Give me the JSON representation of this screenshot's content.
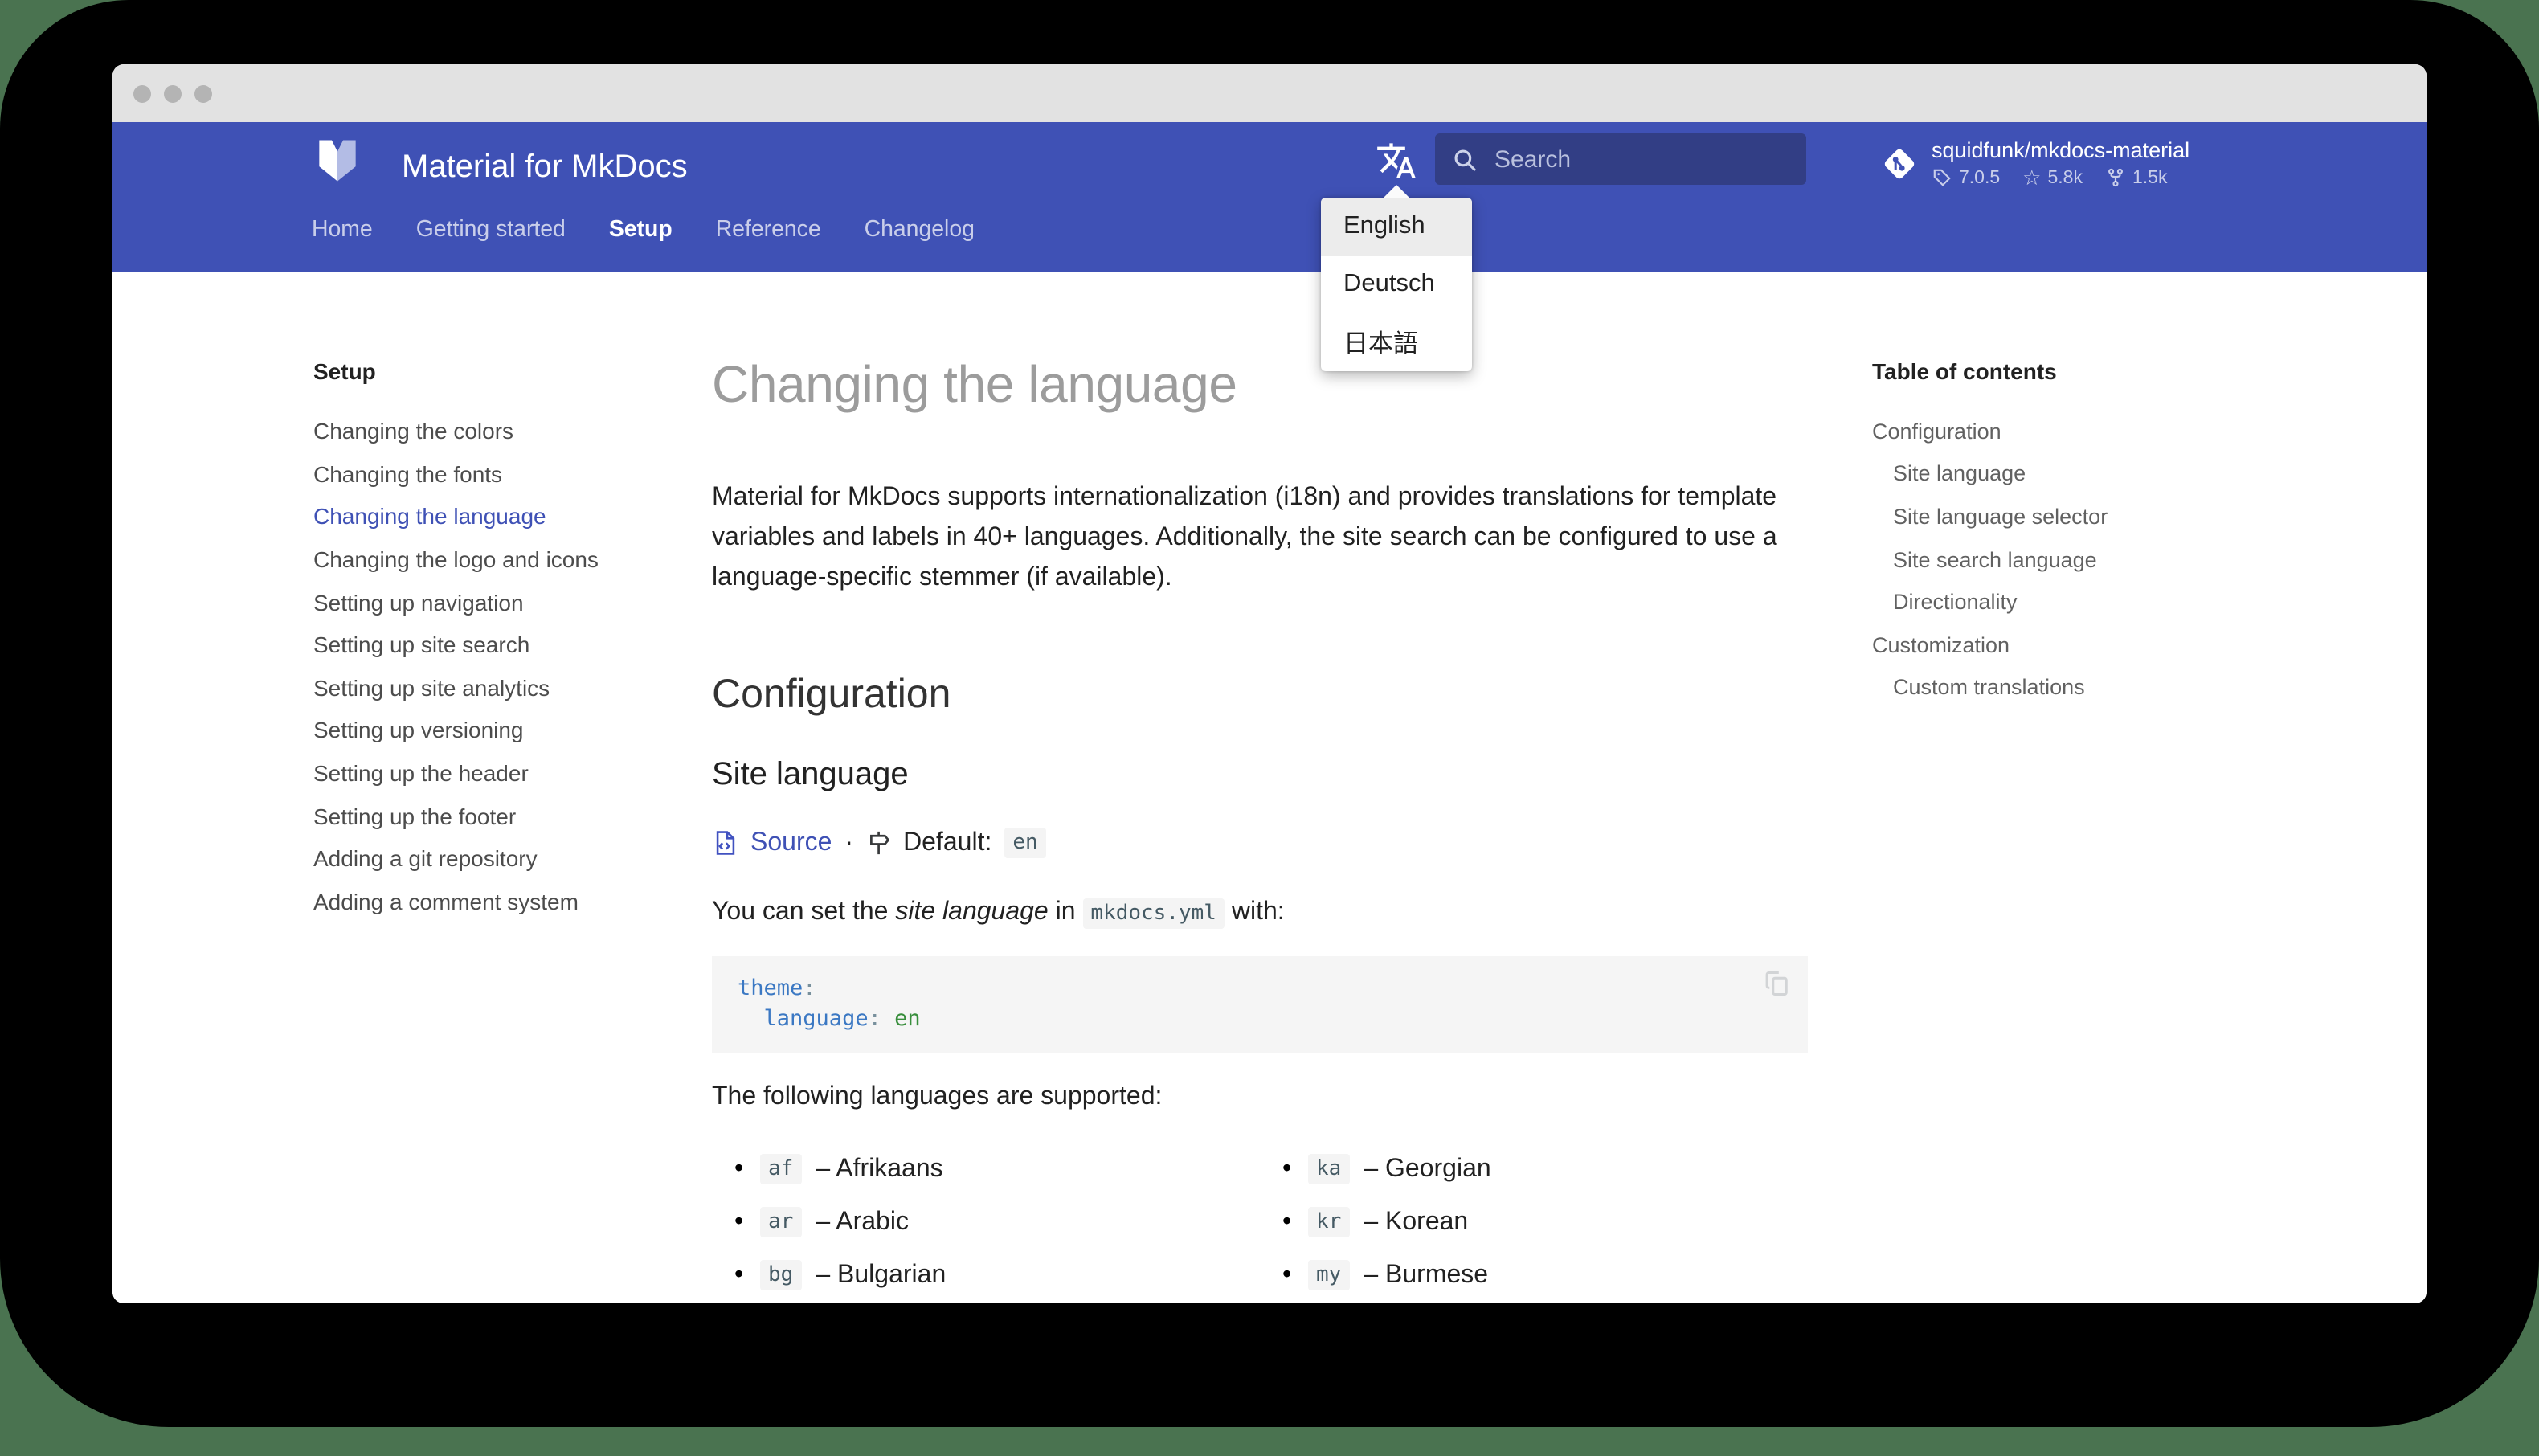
{
  "colors": {
    "desktop": "#4a7350",
    "header": "#3f51b5",
    "accent": "#3f51b5",
    "code_key": "#3b78c3",
    "code_value": "#388e3c"
  },
  "header": {
    "title": "Material for MkDocs",
    "search_placeholder": "Search",
    "tabs": [
      {
        "label": "Home",
        "class": ""
      },
      {
        "label": "Getting started",
        "class": ""
      },
      {
        "label": "Setup",
        "class": "active"
      },
      {
        "label": "Reference",
        "class": ""
      },
      {
        "label": "Changelog",
        "class": ""
      }
    ],
    "repo": {
      "name": "squidfunk/mkdocs-material",
      "version": "7.0.5",
      "stars": "5.8k",
      "forks": "1.5k"
    }
  },
  "language_menu": {
    "items": [
      {
        "label": "English",
        "class": "active"
      },
      {
        "label": "Deutsch",
        "class": ""
      },
      {
        "label": "日本語",
        "class": ""
      }
    ]
  },
  "sidebar": {
    "title": "Setup",
    "items": [
      {
        "label": "Changing the colors",
        "class": ""
      },
      {
        "label": "Changing the fonts",
        "class": ""
      },
      {
        "label": "Changing the language",
        "class": "active"
      },
      {
        "label": "Changing the logo and icons",
        "class": ""
      },
      {
        "label": "Setting up navigation",
        "class": ""
      },
      {
        "label": "Setting up site search",
        "class": ""
      },
      {
        "label": "Setting up site analytics",
        "class": ""
      },
      {
        "label": "Setting up versioning",
        "class": ""
      },
      {
        "label": "Setting up the header",
        "class": ""
      },
      {
        "label": "Setting up the footer",
        "class": ""
      },
      {
        "label": "Adding a git repository",
        "class": ""
      },
      {
        "label": "Adding a comment system",
        "class": ""
      }
    ]
  },
  "toc": {
    "title": "Table of contents",
    "items": [
      {
        "label": "Configuration",
        "class": ""
      },
      {
        "label": "Site language",
        "class": "lvl2"
      },
      {
        "label": "Site language selector",
        "class": "lvl2"
      },
      {
        "label": "Site search language",
        "class": "lvl2"
      },
      {
        "label": "Directionality",
        "class": "lvl2"
      },
      {
        "label": "Customization",
        "class": ""
      },
      {
        "label": "Custom translations",
        "class": "lvl2"
      }
    ]
  },
  "content": {
    "h1": "Changing the language",
    "intro": "Material for MkDocs supports internationalization (i18n) and provides translations for template variables and labels in 40+ languages. Additionally, the site search can be configured to use a language-specific stemmer (if available).",
    "h2": "Configuration",
    "h3": "Site language",
    "source_label": "Source",
    "sep": "·",
    "default_label": "Default:",
    "default_value": "en",
    "set_pre": "You can set the ",
    "set_em": "site language",
    "set_mid": " in ",
    "set_code": "mkdocs.yml",
    "set_post": " with:",
    "code": {
      "l1_key": "theme",
      "l1_colon": ":",
      "l2_indent": "  ",
      "l2_key": "language",
      "l2_colon": ": ",
      "l2_value": "en"
    },
    "supported_intro": "The following languages are supported:",
    "dash": "–",
    "languages_left": [
      {
        "code": "af",
        "name": "Afrikaans"
      },
      {
        "code": "ar",
        "name": "Arabic"
      },
      {
        "code": "bg",
        "name": "Bulgarian"
      }
    ],
    "languages_right": [
      {
        "code": "ka",
        "name": "Georgian"
      },
      {
        "code": "kr",
        "name": "Korean"
      },
      {
        "code": "my",
        "name": "Burmese"
      }
    ]
  }
}
